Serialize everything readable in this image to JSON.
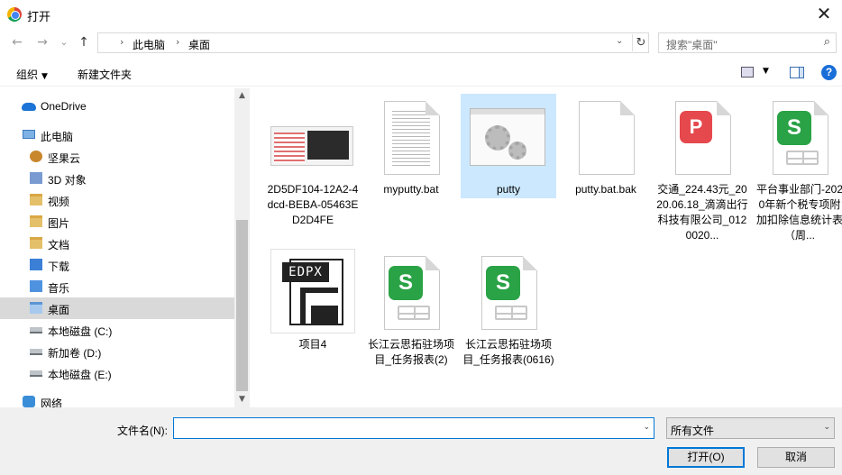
{
  "window": {
    "title": "打开",
    "close_symbol": "✕"
  },
  "nav": {
    "back_symbol": "←",
    "forward_symbol": "→",
    "recent_symbol": "⌄",
    "up_symbol": "↑",
    "breadcrumb": [
      "此电脑",
      "桌面"
    ],
    "crumb_sep": "›",
    "address_dropdown_symbol": "⌄",
    "refresh_symbol": "↻",
    "search_placeholder": "搜索\"桌面\"",
    "search_symbol": "⌕"
  },
  "toolbar": {
    "organize": "组织",
    "new_folder": "新建文件夹",
    "help": "?"
  },
  "sidebar": {
    "items": [
      {
        "label": "OneDrive",
        "icon": "onedrive-icon"
      },
      {
        "label": "此电脑",
        "icon": "computer-icon"
      },
      {
        "label": "坚果云",
        "icon": "nutstore-icon"
      },
      {
        "label": "3D 对象",
        "icon": "3d-objects-icon"
      },
      {
        "label": "视频",
        "icon": "videos-folder-icon"
      },
      {
        "label": "图片",
        "icon": "pictures-folder-icon"
      },
      {
        "label": "文档",
        "icon": "documents-folder-icon"
      },
      {
        "label": "下载",
        "icon": "downloads-folder-icon"
      },
      {
        "label": "音乐",
        "icon": "music-folder-icon"
      },
      {
        "label": "桌面",
        "icon": "desktop-folder-icon",
        "selected": true
      },
      {
        "label": "本地磁盘 (C:)",
        "icon": "drive-icon"
      },
      {
        "label": "新加卷 (D:)",
        "icon": "drive-icon"
      },
      {
        "label": "本地磁盘 (E:)",
        "icon": "drive-icon"
      },
      {
        "label": "网络",
        "icon": "network-icon"
      }
    ]
  },
  "files": [
    {
      "name": "2D5DF104-12A2-4dcd-BEBA-05463ED2D4FE",
      "kind": "image"
    },
    {
      "name": "myputty.bat",
      "kind": "batch"
    },
    {
      "name": "putty",
      "kind": "application",
      "selected": true
    },
    {
      "name": "putty.bat.bak",
      "kind": "blank"
    },
    {
      "name": "交通_224.43元_2020.06.18_滴滴出行科技有限公司_0120020...",
      "kind": "pdf",
      "badge": "P"
    },
    {
      "name": "平台事业部门-2020年新个税专项附加扣除信息统计表（周...",
      "kind": "spreadsheet",
      "badge": "S"
    },
    {
      "name": "项目4",
      "kind": "edpx",
      "badge": "EDPX"
    },
    {
      "name": "长江云思拓驻场项目_任务报表(2)",
      "kind": "spreadsheet",
      "badge": "S"
    },
    {
      "name": "长江云思拓驻场项目_任务报表(0616)",
      "kind": "spreadsheet",
      "badge": "S"
    }
  ],
  "bottom": {
    "filename_label": "文件名(N):",
    "filename_value": "",
    "filetype": "所有文件",
    "open": "打开(O)",
    "cancel": "取消",
    "dropdown_symbol": "⌄"
  },
  "colors": {
    "selection": "#cce8ff",
    "sidebar_selection": "#d9d9d9",
    "accent": "#0078d7"
  }
}
